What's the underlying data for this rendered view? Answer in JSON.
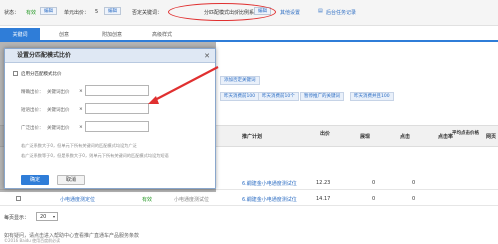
{
  "topbar": {
    "status_label": "状态：",
    "status_value": "有效",
    "unit_bid_label": "单元出价：",
    "unit_bid_value": "5",
    "edit_label": "编辑",
    "negative_kw_label": "否定关键词：",
    "ratio_label": "分匹配模式出价比例系数：",
    "ratio_value": "- - / - -",
    "other_settings": "其他设置",
    "history_link": "后台任务记录"
  },
  "tabs": [
    "关键词",
    "创意",
    "附加创意",
    "高级样式"
  ],
  "toolbar": {
    "btn_1": "关键词出价",
    "btn_2": "更多操作",
    "btn_3": "启用",
    "btn_4": "折叠",
    "btn_5": "添加否定关键词",
    "btn_6": "昨天消费前10个",
    "btn_7": "暂停推广的关键词",
    "btn_8": "昨天消费并且100",
    "btn_9": "昨天消费前100"
  },
  "table": {
    "headers": [
      "推广计划",
      "出价",
      "展现",
      "点击",
      "点击率",
      "平均点击价格",
      "网页"
    ],
    "rows": [
      {
        "plan": "6.繝建金小电通度测试位",
        "bid": "12.23",
        "impr": "0",
        "clicks": "0"
      },
      {
        "plan": "6.繝建金小电通度测试位",
        "bid": "14.17",
        "impr": "0",
        "clicks": "0"
      }
    ],
    "row_keyword": "小电通度测定位",
    "row_status": "有效",
    "row_unit": "小电通度测试位"
  },
  "dialog": {
    "title": "设置分匹配模式比价",
    "enable_label": "启用分匹配模式比价",
    "close_glyph": "✕",
    "fields": [
      {
        "label": "精确出价：",
        "sub": "关键词出价",
        "sign": "×"
      },
      {
        "label": "短语出价：",
        "sub": "关键词出价",
        "sign": "×"
      },
      {
        "label": "广泛出价：",
        "sub": "关键词出价",
        "sign": "×"
      }
    ],
    "note_1": "若广泛系数大于0，但单元下所有关键词的匹配模式均设为广泛",
    "note_2": "若广泛系数等于0，但是系数大于0，则单元下所有关键词的匹配模式均设为短语",
    "ok_label": "确定",
    "cancel_label": "取消"
  },
  "footer": {
    "per_page_label": "每页显示：",
    "per_page_value": "20",
    "help_text": "如有疑问，请点击进入帮助中心查看推广直通车产品服务条款",
    "copyright": "©2016 Baidu 使用百度前必读"
  },
  "colors": {
    "accent": "#2f7dd8",
    "highlight": "#e03030",
    "link": "#2f6fc4",
    "status_ok": "#2a9b2a"
  }
}
